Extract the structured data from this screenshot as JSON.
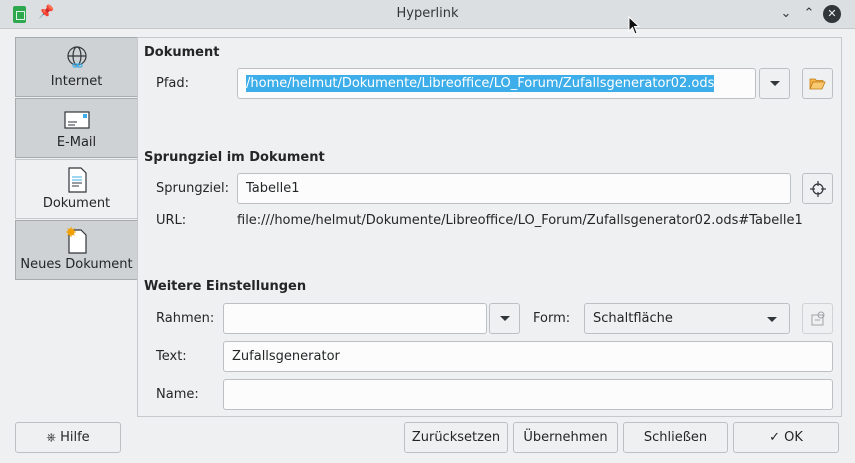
{
  "titlebar": {
    "title": "Hyperlink"
  },
  "sidebar": {
    "items": [
      {
        "label": "Internet",
        "icon": "globe-link-icon"
      },
      {
        "label": "E-Mail",
        "icon": "envelope-icon"
      },
      {
        "label": "Dokument",
        "icon": "document-icon"
      },
      {
        "label": "Neues Dokument",
        "icon": "new-document-icon"
      }
    ],
    "active": "Dokument"
  },
  "document": {
    "section_title": "Dokument",
    "path_label": "Pfad:",
    "path_value": "/home/helmut/Dokumente/Libreoffice/LO_Forum/Zufallsgenerator02.ods"
  },
  "target": {
    "section_title": "Sprungziel im Dokument",
    "target_label": "Sprungziel:",
    "target_value": "Tabelle1",
    "url_label": "URL:",
    "url_value": "file:///home/helmut/Dokumente/Libreoffice/LO_Forum/Zufallsgenerator02.ods#Tabelle1"
  },
  "settings": {
    "section_title": "Weitere Einstellungen",
    "frame_label": "Rahmen:",
    "frame_value": "",
    "form_label": "Form:",
    "form_value": "Schaltfläche",
    "text_label": "Text:",
    "text_value": "Zufallsgenerator",
    "name_label": "Name:",
    "name_value": ""
  },
  "footer": {
    "help": "Hilfe",
    "reset": "Zurücksetzen",
    "apply": "Übernehmen",
    "close": "Schließen",
    "ok": "OK"
  },
  "colors": {
    "selection": "#3daee9",
    "accent_icon": "#f2a000",
    "app_icon": "#2ea84f"
  }
}
